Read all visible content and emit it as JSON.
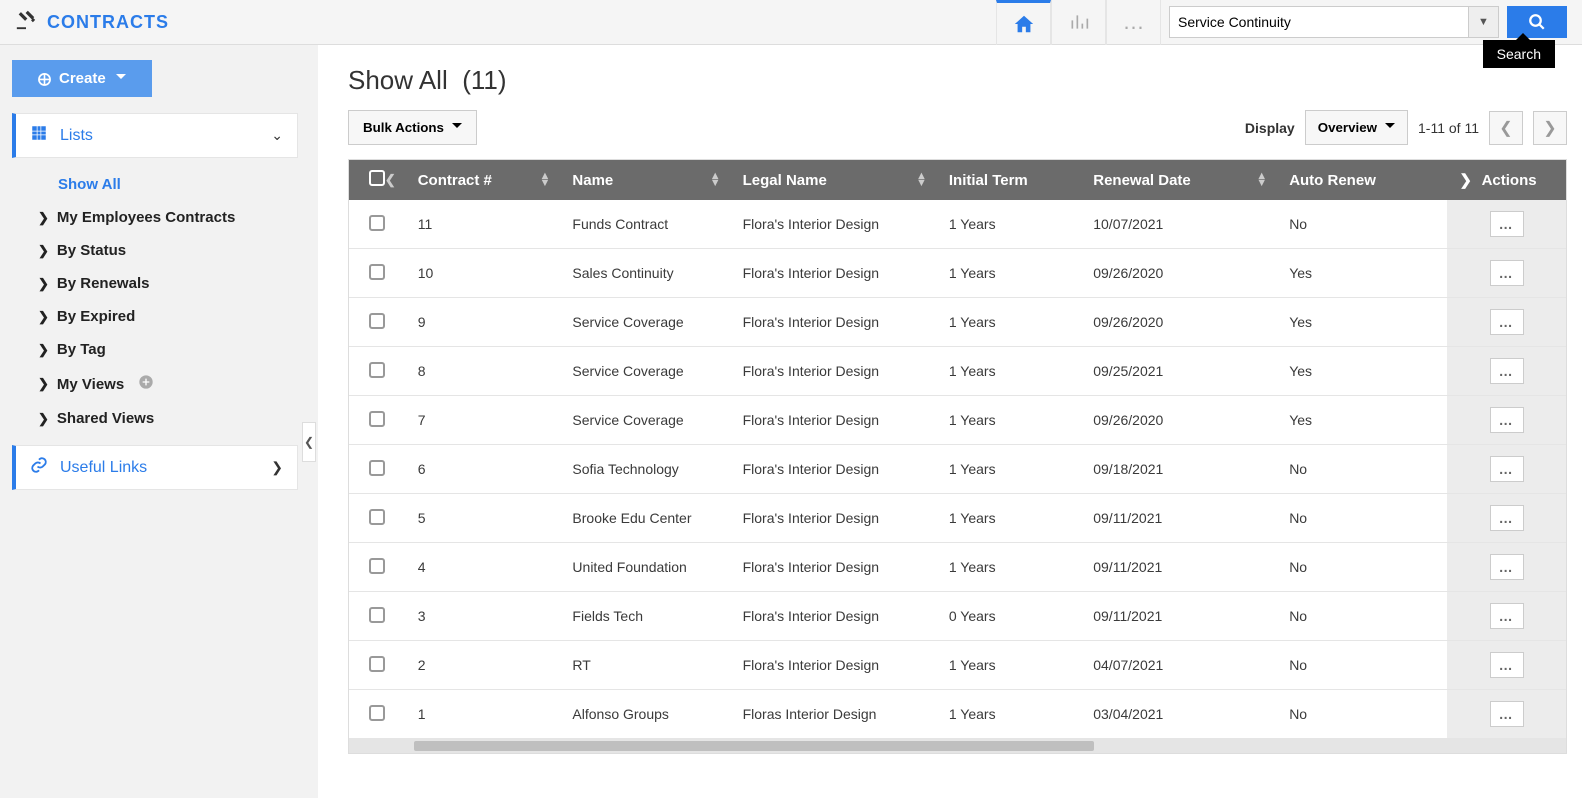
{
  "brand": "CONTRACTS",
  "search": {
    "value": "Service Continuity",
    "tooltip": "Search"
  },
  "sidebar": {
    "create_label": "Create",
    "lists_label": "Lists",
    "links_label": "Useful Links",
    "items": [
      {
        "label": "Show All"
      },
      {
        "label": "My Employees Contracts"
      },
      {
        "label": "By Status"
      },
      {
        "label": "By Renewals"
      },
      {
        "label": "By Expired"
      },
      {
        "label": "By Tag"
      },
      {
        "label": "My Views"
      },
      {
        "label": "Shared Views"
      }
    ]
  },
  "page": {
    "title_prefix": "Show All",
    "count_text": "(11)",
    "bulk_label": "Bulk Actions",
    "display_label": "Display",
    "overview_label": "Overview",
    "pager_text": "1-11 of 11"
  },
  "columns": {
    "contract_no": "Contract #",
    "name": "Name",
    "legal_name": "Legal Name",
    "initial_term": "Initial Term",
    "renewal_date": "Renewal Date",
    "auto_renew": "Auto Renew",
    "actions": "Actions"
  },
  "rows": [
    {
      "no": "11",
      "name": "Funds Contract",
      "legal": "Flora's Interior Design",
      "term": "1 Years",
      "renewal": "10/07/2021",
      "auto": "No"
    },
    {
      "no": "10",
      "name": "Sales Continuity",
      "legal": "Flora's Interior Design",
      "term": "1 Years",
      "renewal": "09/26/2020",
      "auto": "Yes"
    },
    {
      "no": "9",
      "name": "Service Coverage",
      "legal": "Flora's Interior Design",
      "term": "1 Years",
      "renewal": "09/26/2020",
      "auto": "Yes"
    },
    {
      "no": "8",
      "name": "Service Coverage",
      "legal": "Flora's Interior Design",
      "term": "1 Years",
      "renewal": "09/25/2021",
      "auto": "Yes"
    },
    {
      "no": "7",
      "name": "Service Coverage",
      "legal": "Flora's Interior Design",
      "term": "1 Years",
      "renewal": "09/26/2020",
      "auto": "Yes"
    },
    {
      "no": "6",
      "name": "Sofia Technology",
      "legal": "Flora's Interior Design",
      "term": "1 Years",
      "renewal": "09/18/2021",
      "auto": "No"
    },
    {
      "no": "5",
      "name": "Brooke Edu Center",
      "legal": "Flora's Interior Design",
      "term": "1 Years",
      "renewal": "09/11/2021",
      "auto": "No"
    },
    {
      "no": "4",
      "name": "United Foundation",
      "legal": "Flora's Interior Design",
      "term": "1 Years",
      "renewal": "09/11/2021",
      "auto": "No"
    },
    {
      "no": "3",
      "name": "Fields Tech",
      "legal": "Flora's Interior Design",
      "term": "0 Years",
      "renewal": "09/11/2021",
      "auto": "No"
    },
    {
      "no": "2",
      "name": "RT",
      "legal": "Flora's Interior Design",
      "term": "1 Years",
      "renewal": "04/07/2021",
      "auto": "No"
    },
    {
      "no": "1",
      "name": "Alfonso Groups",
      "legal": "Floras Interior Design",
      "term": "1 Years",
      "renewal": "03/04/2021",
      "auto": "No"
    }
  ]
}
